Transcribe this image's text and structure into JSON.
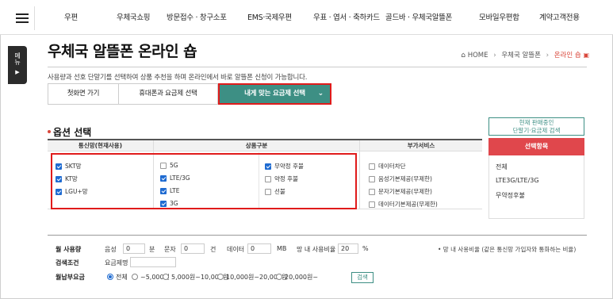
{
  "nav": {
    "items": [
      "우편",
      "우체국쇼핑",
      "방문접수 · 창구소포",
      "EMS·국제우편",
      "우표 · 엽서 · 축하카드",
      "골드바 · 우체국알뜰폰",
      "모바일우편함",
      "계약고객전용"
    ]
  },
  "side_menu": {
    "label": "메뉴",
    "arrow": "▶"
  },
  "page": {
    "title": "우체국 알뜰폰 온라인 숍",
    "description": "사용량과 선호 단말기를 선택하여 상품 추천을 하며 온라인에서 바로 알뜰폰 신청이 가능합니다."
  },
  "breadcrumb": {
    "home": "HOME",
    "level1": "우체국 알뜰폰",
    "current": "온라인 숍"
  },
  "tabs": {
    "first": "첫화면 가기",
    "second": "휴대폰과 요금제 선택",
    "third": "내게 맞는 요금제 선택",
    "chevron": "⌄"
  },
  "options": {
    "title": "옵션 선택",
    "headers": {
      "network": "통신망(현재사용)",
      "product": "상품구분",
      "service": "부가서비스"
    },
    "network": [
      {
        "label": "SKT망",
        "checked": true
      },
      {
        "label": "KT망",
        "checked": true
      },
      {
        "label": "LGU+망",
        "checked": true
      }
    ],
    "product_col1": [
      {
        "label": "5G",
        "checked": false
      },
      {
        "label": "LTE/3G",
        "checked": true
      },
      {
        "label": "LTE",
        "checked": true
      },
      {
        "label": "3G",
        "checked": true
      }
    ],
    "product_col2": [
      {
        "label": "무약정 후불",
        "checked": true
      },
      {
        "label": "약정 후불",
        "checked": false
      },
      {
        "label": "선불",
        "checked": false
      }
    ],
    "service": [
      {
        "label": "데이터차단",
        "checked": false
      },
      {
        "label": "음성기본제공(무제한)",
        "checked": false
      },
      {
        "label": "문자기본제공(무제한)",
        "checked": false
      },
      {
        "label": "데이터기본제공(무제한)",
        "checked": false
      }
    ]
  },
  "right_panel": {
    "search_button": "현재 판매중인\n단말기·요금제 검색",
    "selected_header": "선택항목",
    "items": [
      "전체",
      "LTE3G/LTE/3G",
      "무약정후불"
    ]
  },
  "filter": {
    "monthly_usage_label": "월 사용량",
    "voice_label": "음성",
    "voice_value": "0",
    "voice_unit": "분",
    "sms_label": "문자",
    "sms_value": "0",
    "sms_unit": "건",
    "data_label": "데이터",
    "data_value": "0",
    "data_unit": "MB",
    "onnet_label": "망 내 사용비율",
    "onnet_value": "20",
    "onnet_unit": "%",
    "onnet_note": "• 망 내 사용비율 (같은 통신망 가입자와 통화하는 비율)",
    "search_cond_label": "검색조건",
    "plan_name_label": "요금제명",
    "fee_label": "월납부요금",
    "fee_options": [
      {
        "label": "전체",
        "selected": true
      },
      {
        "label": "~5,000원",
        "selected": false
      },
      {
        "label": "5,000원~10,000원",
        "selected": false
      },
      {
        "label": "10,000원~20,000원",
        "selected": false
      },
      {
        "label": "20,000원~",
        "selected": false
      }
    ],
    "search_button": "검색"
  },
  "colors": {
    "accent_teal": "#3d8f84",
    "highlight_red": "#e01b1b",
    "header_red": "#e0474c",
    "check_blue": "#1f6bd1"
  }
}
